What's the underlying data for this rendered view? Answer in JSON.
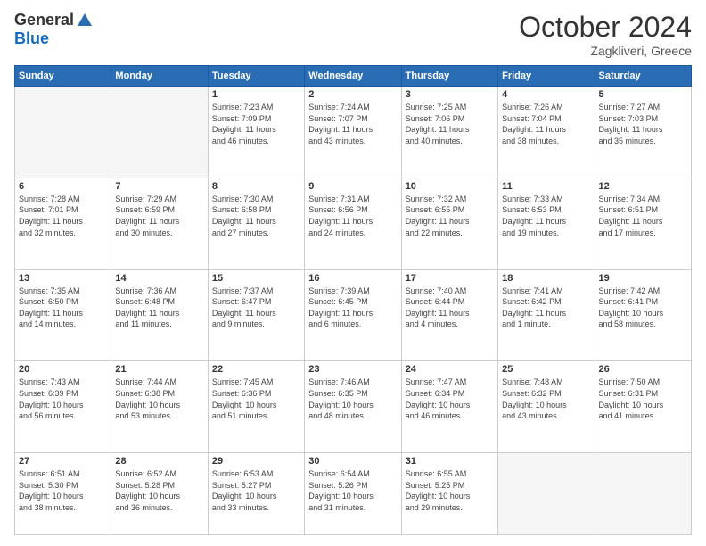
{
  "header": {
    "logo_general": "General",
    "logo_blue": "Blue",
    "month": "October 2024",
    "location": "Zagkliveri, Greece"
  },
  "days_of_week": [
    "Sunday",
    "Monday",
    "Tuesday",
    "Wednesday",
    "Thursday",
    "Friday",
    "Saturday"
  ],
  "weeks": [
    [
      {
        "day": "",
        "info": ""
      },
      {
        "day": "",
        "info": ""
      },
      {
        "day": "1",
        "info": "Sunrise: 7:23 AM\nSunset: 7:09 PM\nDaylight: 11 hours\nand 46 minutes."
      },
      {
        "day": "2",
        "info": "Sunrise: 7:24 AM\nSunset: 7:07 PM\nDaylight: 11 hours\nand 43 minutes."
      },
      {
        "day": "3",
        "info": "Sunrise: 7:25 AM\nSunset: 7:06 PM\nDaylight: 11 hours\nand 40 minutes."
      },
      {
        "day": "4",
        "info": "Sunrise: 7:26 AM\nSunset: 7:04 PM\nDaylight: 11 hours\nand 38 minutes."
      },
      {
        "day": "5",
        "info": "Sunrise: 7:27 AM\nSunset: 7:03 PM\nDaylight: 11 hours\nand 35 minutes."
      }
    ],
    [
      {
        "day": "6",
        "info": "Sunrise: 7:28 AM\nSunset: 7:01 PM\nDaylight: 11 hours\nand 32 minutes."
      },
      {
        "day": "7",
        "info": "Sunrise: 7:29 AM\nSunset: 6:59 PM\nDaylight: 11 hours\nand 30 minutes."
      },
      {
        "day": "8",
        "info": "Sunrise: 7:30 AM\nSunset: 6:58 PM\nDaylight: 11 hours\nand 27 minutes."
      },
      {
        "day": "9",
        "info": "Sunrise: 7:31 AM\nSunset: 6:56 PM\nDaylight: 11 hours\nand 24 minutes."
      },
      {
        "day": "10",
        "info": "Sunrise: 7:32 AM\nSunset: 6:55 PM\nDaylight: 11 hours\nand 22 minutes."
      },
      {
        "day": "11",
        "info": "Sunrise: 7:33 AM\nSunset: 6:53 PM\nDaylight: 11 hours\nand 19 minutes."
      },
      {
        "day": "12",
        "info": "Sunrise: 7:34 AM\nSunset: 6:51 PM\nDaylight: 11 hours\nand 17 minutes."
      }
    ],
    [
      {
        "day": "13",
        "info": "Sunrise: 7:35 AM\nSunset: 6:50 PM\nDaylight: 11 hours\nand 14 minutes."
      },
      {
        "day": "14",
        "info": "Sunrise: 7:36 AM\nSunset: 6:48 PM\nDaylight: 11 hours\nand 11 minutes."
      },
      {
        "day": "15",
        "info": "Sunrise: 7:37 AM\nSunset: 6:47 PM\nDaylight: 11 hours\nand 9 minutes."
      },
      {
        "day": "16",
        "info": "Sunrise: 7:39 AM\nSunset: 6:45 PM\nDaylight: 11 hours\nand 6 minutes."
      },
      {
        "day": "17",
        "info": "Sunrise: 7:40 AM\nSunset: 6:44 PM\nDaylight: 11 hours\nand 4 minutes."
      },
      {
        "day": "18",
        "info": "Sunrise: 7:41 AM\nSunset: 6:42 PM\nDaylight: 11 hours\nand 1 minute."
      },
      {
        "day": "19",
        "info": "Sunrise: 7:42 AM\nSunset: 6:41 PM\nDaylight: 10 hours\nand 58 minutes."
      }
    ],
    [
      {
        "day": "20",
        "info": "Sunrise: 7:43 AM\nSunset: 6:39 PM\nDaylight: 10 hours\nand 56 minutes."
      },
      {
        "day": "21",
        "info": "Sunrise: 7:44 AM\nSunset: 6:38 PM\nDaylight: 10 hours\nand 53 minutes."
      },
      {
        "day": "22",
        "info": "Sunrise: 7:45 AM\nSunset: 6:36 PM\nDaylight: 10 hours\nand 51 minutes."
      },
      {
        "day": "23",
        "info": "Sunrise: 7:46 AM\nSunset: 6:35 PM\nDaylight: 10 hours\nand 48 minutes."
      },
      {
        "day": "24",
        "info": "Sunrise: 7:47 AM\nSunset: 6:34 PM\nDaylight: 10 hours\nand 46 minutes."
      },
      {
        "day": "25",
        "info": "Sunrise: 7:48 AM\nSunset: 6:32 PM\nDaylight: 10 hours\nand 43 minutes."
      },
      {
        "day": "26",
        "info": "Sunrise: 7:50 AM\nSunset: 6:31 PM\nDaylight: 10 hours\nand 41 minutes."
      }
    ],
    [
      {
        "day": "27",
        "info": "Sunrise: 6:51 AM\nSunset: 5:30 PM\nDaylight: 10 hours\nand 38 minutes."
      },
      {
        "day": "28",
        "info": "Sunrise: 6:52 AM\nSunset: 5:28 PM\nDaylight: 10 hours\nand 36 minutes."
      },
      {
        "day": "29",
        "info": "Sunrise: 6:53 AM\nSunset: 5:27 PM\nDaylight: 10 hours\nand 33 minutes."
      },
      {
        "day": "30",
        "info": "Sunrise: 6:54 AM\nSunset: 5:26 PM\nDaylight: 10 hours\nand 31 minutes."
      },
      {
        "day": "31",
        "info": "Sunrise: 6:55 AM\nSunset: 5:25 PM\nDaylight: 10 hours\nand 29 minutes."
      },
      {
        "day": "",
        "info": ""
      },
      {
        "day": "",
        "info": ""
      }
    ]
  ]
}
